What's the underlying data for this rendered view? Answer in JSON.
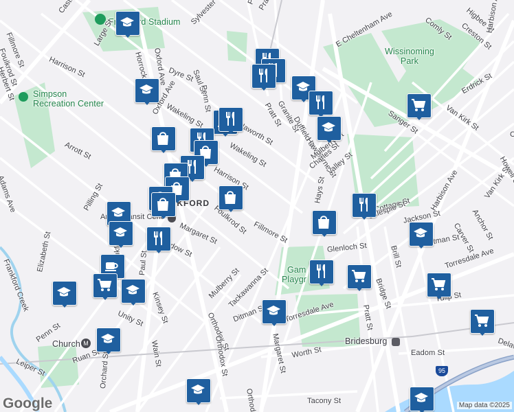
{
  "map": {
    "google_logo": "Google",
    "attribution": "Map data ©2025",
    "parks": {
      "stadium": "Frankford Stadium",
      "wissinoming": "Wissinoming\nPark",
      "simpson": "Simpson\nRecreation Center",
      "gambrel": "Gam",
      "gambrel2": "Playgr"
    },
    "areas": {
      "frankford": "FRANKFORD"
    },
    "places": {
      "church": "Church",
      "bridesburg": "Bridesburg",
      "arrott": "Arrott Transit Cent"
    },
    "highway": "95",
    "streets": [
      {
        "t": "Castor Ave"
      },
      {
        "t": "Fillmore St"
      },
      {
        "t": "Foulkrod St"
      },
      {
        "t": "Herbert St"
      },
      {
        "t": "Large St"
      },
      {
        "t": "Harrison St"
      },
      {
        "t": "Horrocks St"
      },
      {
        "t": "Oxford Ave"
      },
      {
        "t": "Dyre St"
      },
      {
        "t": "Saul St"
      },
      {
        "t": "Wakeling St"
      },
      {
        "t": "Penn St"
      },
      {
        "t": "Sylvester St"
      },
      {
        "t": "Haworth St"
      },
      {
        "t": "Wakeling St"
      },
      {
        "t": "Pratt St"
      },
      {
        "t": "Granite St"
      },
      {
        "t": "Duffield St"
      },
      {
        "t": "Hawthorne St"
      },
      {
        "t": "Mulberry St"
      },
      {
        "t": "Charles St"
      },
      {
        "t": "Valley St"
      },
      {
        "t": "Harrison St"
      },
      {
        "t": "Foulkrod St"
      },
      {
        "t": "Fillmore St"
      },
      {
        "t": "Margaret St"
      },
      {
        "t": "Arrott St"
      },
      {
        "t": "Pilling St"
      },
      {
        "t": "Adams Ave"
      },
      {
        "t": "Elizabeth St"
      },
      {
        "t": "Frankford Creek"
      },
      {
        "t": "Frankford Ave"
      },
      {
        "t": "Paul St"
      },
      {
        "t": "Kinsey St"
      },
      {
        "t": "Unity St"
      },
      {
        "t": "Leiper St"
      },
      {
        "t": "Penn St"
      },
      {
        "t": "Ruan St"
      },
      {
        "t": "Orchard St"
      },
      {
        "t": "Wain St"
      },
      {
        "t": "Mulberry St"
      },
      {
        "t": "Tackawanna St"
      },
      {
        "t": "Ditman St"
      },
      {
        "t": "Orthodox St"
      },
      {
        "t": "Torresdale Ave"
      },
      {
        "t": "Margaret St"
      },
      {
        "t": "Orthodox St"
      },
      {
        "t": "Glenloch St"
      },
      {
        "t": "Bridge St"
      },
      {
        "t": "Pratt St"
      },
      {
        "t": "Brill St"
      },
      {
        "t": "Ditman St"
      },
      {
        "t": "Torresdale Ave"
      },
      {
        "t": "Tulip St"
      },
      {
        "t": "Worth St"
      },
      {
        "t": "Eadom St"
      },
      {
        "t": "Tacony St"
      },
      {
        "t": "E Cheltenham Ave"
      },
      {
        "t": "Comly St"
      },
      {
        "t": "Higbee St"
      },
      {
        "t": "Creston St"
      },
      {
        "t": "Harbison Ave"
      },
      {
        "t": "Erdrick St"
      },
      {
        "t": "Van Kirk St"
      },
      {
        "t": "Sanger St"
      },
      {
        "t": "Cottage St"
      },
      {
        "t": "Gillespie St"
      },
      {
        "t": "Jackson St"
      },
      {
        "t": "Harbison Ave"
      },
      {
        "t": "Anchor St"
      },
      {
        "t": "Carver St"
      },
      {
        "t": "Oxford Ave"
      },
      {
        "t": "Hays St"
      },
      {
        "t": "Meadow St"
      },
      {
        "t": "Orthodox St"
      },
      {
        "t": "Van Kirk St"
      },
      {
        "t": "Howell St"
      },
      {
        "t": "Cottage St"
      },
      {
        "t": "Pratt St"
      },
      {
        "t": "Penn St"
      },
      {
        "t": "Delaware Ave"
      }
    ],
    "markers": [
      {
        "icon": "school-icon"
      },
      {
        "icon": "school-icon"
      },
      {
        "icon": "restaurant-icon"
      },
      {
        "icon": "restaurant-icon"
      },
      {
        "icon": "restaurant-icon"
      },
      {
        "icon": "school-icon"
      },
      {
        "icon": "restaurant-icon"
      },
      {
        "icon": "school-icon"
      },
      {
        "icon": "grocery-icon"
      },
      {
        "icon": "cafe-icon"
      },
      {
        "icon": "restaurant-icon"
      },
      {
        "icon": "shopping-icon"
      },
      {
        "icon": "restaurant-icon"
      },
      {
        "icon": "shopping-icon"
      },
      {
        "icon": "restaurant-icon"
      },
      {
        "icon": "shopping-icon"
      },
      {
        "icon": "shopping-icon"
      },
      {
        "icon": "shopping-icon"
      },
      {
        "icon": "shopping-icon"
      },
      {
        "icon": "shopping-icon"
      },
      {
        "icon": "school-icon"
      },
      {
        "icon": "school-icon"
      },
      {
        "icon": "restaurant-icon"
      },
      {
        "icon": "shopping-icon"
      },
      {
        "icon": "restaurant-icon"
      },
      {
        "icon": "school-icon"
      },
      {
        "icon": "cafe-icon"
      },
      {
        "icon": "grocery-icon"
      },
      {
        "icon": "school-icon"
      },
      {
        "icon": "school-icon"
      },
      {
        "icon": "school-icon"
      },
      {
        "icon": "school-icon"
      },
      {
        "icon": "grocery-icon"
      },
      {
        "icon": "restaurant-icon"
      },
      {
        "icon": "school-icon"
      },
      {
        "icon": "grocery-icon"
      },
      {
        "icon": "grocery-icon"
      },
      {
        "icon": "school-icon"
      },
      {
        "icon": "cafe-icon"
      }
    ]
  }
}
